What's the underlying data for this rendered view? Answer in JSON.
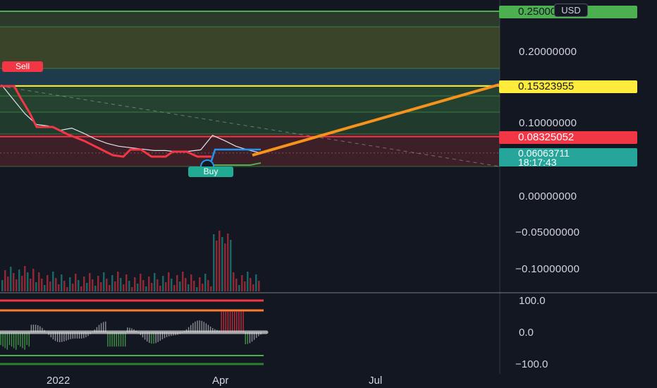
{
  "colors": {
    "background": "#131722",
    "bull": "#26a69a",
    "bear": "#f23645",
    "trend_line": "#f7931a",
    "resistance": "#ffeb3b",
    "fib_line": "#4caf50"
  },
  "toolbar": {
    "currency": "USD"
  },
  "price_axis": {
    "labels": [
      "0.20000000",
      "0.10000000",
      "0.00000000",
      "−0.05000000",
      "−0.10000000"
    ]
  },
  "badges": {
    "fib_top": "0.25000009",
    "resistance": "0.15323955",
    "support": "0.08325052",
    "last_price": "0.06063711",
    "countdown": "18:17:43"
  },
  "signals": {
    "sell": "Sell",
    "buy": "Buy"
  },
  "oscillator_axis": {
    "labels": [
      "100.0",
      "0.0",
      "−100.0"
    ]
  },
  "time_axis": {
    "labels": [
      "2022",
      "Apr",
      "Jul"
    ]
  },
  "chart_data": {
    "type": "line",
    "xlabel": "",
    "ylabel": "",
    "x": [
      "2022",
      "Apr",
      "Jul"
    ],
    "ylim": [
      -0.1,
      0.25
    ],
    "series": [
      {
        "values": [
          0.155,
          0.135,
          0.115,
          0.1,
          0.098,
          0.092,
          0.095,
          0.088,
          0.08,
          0.074,
          0.07,
          0.068,
          0.066,
          0.064,
          0.064,
          0.062,
          0.063,
          0.065,
          0.085,
          0.078,
          0.07,
          0.065,
          0.061
        ]
      }
    ],
    "horizontal_levels": [
      0.25000009,
      0.15323955,
      0.08325052,
      0.06063711
    ],
    "oscillator_ylim": [
      -100,
      100
    ]
  }
}
